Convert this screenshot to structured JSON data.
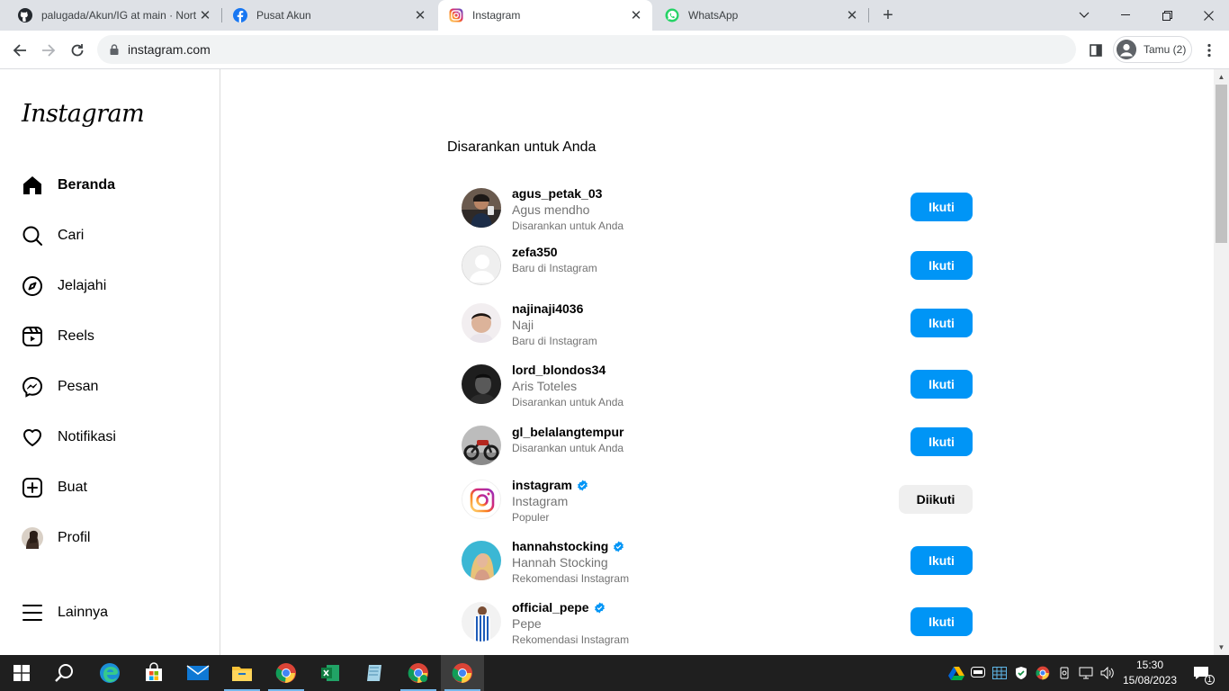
{
  "browser": {
    "tabs": [
      {
        "title": "palugada/Akun/IG at main · Nort",
        "icon": "github-icon"
      },
      {
        "title": "Pusat Akun",
        "icon": "facebook-icon"
      },
      {
        "title": "Instagram",
        "icon": "instagram-icon",
        "active": true
      },
      {
        "title": "WhatsApp",
        "icon": "whatsapp-icon"
      }
    ],
    "url": "instagram.com",
    "profile_label": "Tamu (2)"
  },
  "sidebar": {
    "logo": "Instagram",
    "items": [
      {
        "label": "Beranda",
        "icon": "home-icon"
      },
      {
        "label": "Cari",
        "icon": "search-icon"
      },
      {
        "label": "Jelajahi",
        "icon": "compass-icon"
      },
      {
        "label": "Reels",
        "icon": "reels-icon"
      },
      {
        "label": "Pesan",
        "icon": "messenger-icon"
      },
      {
        "label": "Notifikasi",
        "icon": "heart-icon"
      },
      {
        "label": "Buat",
        "icon": "plus-square-icon"
      },
      {
        "label": "Profil",
        "icon": "profile-avatar"
      }
    ],
    "more_label": "Lainnya"
  },
  "main": {
    "heading": "Disarankan untuk Anda",
    "suggestions": [
      {
        "username": "agus_petak_03",
        "name": "Agus mendho",
        "reason": "Disarankan untuk Anda",
        "button": "Ikuti",
        "verified": false
      },
      {
        "username": "zefa350",
        "name": "",
        "reason": "Baru di Instagram",
        "button": "Ikuti",
        "verified": false
      },
      {
        "username": "najinaji4036",
        "name": "Naji",
        "reason": "Baru di Instagram",
        "button": "Ikuti",
        "verified": false
      },
      {
        "username": "lord_blondos34",
        "name": "Aris Toteles",
        "reason": "Disarankan untuk Anda",
        "button": "Ikuti",
        "verified": false
      },
      {
        "username": "gl_belalangtempur",
        "name": "",
        "reason": "Disarankan untuk Anda",
        "button": "Ikuti",
        "verified": false
      },
      {
        "username": "instagram",
        "name": "Instagram",
        "reason": "Populer",
        "button": "Diikuti",
        "verified": true
      },
      {
        "username": "hannahstocking",
        "name": "Hannah Stocking",
        "reason": "Rekomendasi Instagram",
        "button": "Ikuti",
        "verified": true
      },
      {
        "username": "official_pepe",
        "name": "Pepe",
        "reason": "Rekomendasi Instagram",
        "button": "Ikuti",
        "verified": true
      }
    ]
  },
  "taskbar": {
    "time": "15:30",
    "date": "15/08/2023",
    "notification_count": "1"
  },
  "colors": {
    "follow_button": "#0095f6",
    "following_button": "#efefef",
    "verified_badge": "#0095f6"
  }
}
